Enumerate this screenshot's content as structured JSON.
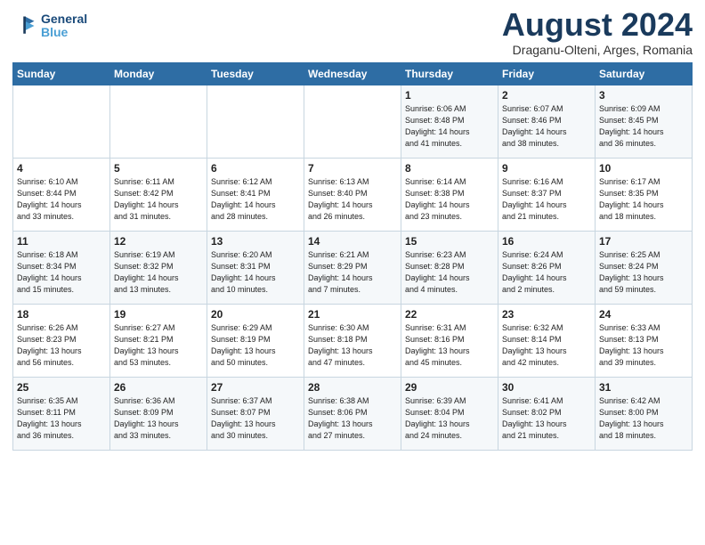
{
  "header": {
    "logo_line1": "General",
    "logo_line2": "Blue",
    "month": "August 2024",
    "location": "Draganu-Olteni, Arges, Romania"
  },
  "days_of_week": [
    "Sunday",
    "Monday",
    "Tuesday",
    "Wednesday",
    "Thursday",
    "Friday",
    "Saturday"
  ],
  "weeks": [
    [
      {
        "day": "",
        "info": ""
      },
      {
        "day": "",
        "info": ""
      },
      {
        "day": "",
        "info": ""
      },
      {
        "day": "",
        "info": ""
      },
      {
        "day": "1",
        "info": "Sunrise: 6:06 AM\nSunset: 8:48 PM\nDaylight: 14 hours\nand 41 minutes."
      },
      {
        "day": "2",
        "info": "Sunrise: 6:07 AM\nSunset: 8:46 PM\nDaylight: 14 hours\nand 38 minutes."
      },
      {
        "day": "3",
        "info": "Sunrise: 6:09 AM\nSunset: 8:45 PM\nDaylight: 14 hours\nand 36 minutes."
      }
    ],
    [
      {
        "day": "4",
        "info": "Sunrise: 6:10 AM\nSunset: 8:44 PM\nDaylight: 14 hours\nand 33 minutes."
      },
      {
        "day": "5",
        "info": "Sunrise: 6:11 AM\nSunset: 8:42 PM\nDaylight: 14 hours\nand 31 minutes."
      },
      {
        "day": "6",
        "info": "Sunrise: 6:12 AM\nSunset: 8:41 PM\nDaylight: 14 hours\nand 28 minutes."
      },
      {
        "day": "7",
        "info": "Sunrise: 6:13 AM\nSunset: 8:40 PM\nDaylight: 14 hours\nand 26 minutes."
      },
      {
        "day": "8",
        "info": "Sunrise: 6:14 AM\nSunset: 8:38 PM\nDaylight: 14 hours\nand 23 minutes."
      },
      {
        "day": "9",
        "info": "Sunrise: 6:16 AM\nSunset: 8:37 PM\nDaylight: 14 hours\nand 21 minutes."
      },
      {
        "day": "10",
        "info": "Sunrise: 6:17 AM\nSunset: 8:35 PM\nDaylight: 14 hours\nand 18 minutes."
      }
    ],
    [
      {
        "day": "11",
        "info": "Sunrise: 6:18 AM\nSunset: 8:34 PM\nDaylight: 14 hours\nand 15 minutes."
      },
      {
        "day": "12",
        "info": "Sunrise: 6:19 AM\nSunset: 8:32 PM\nDaylight: 14 hours\nand 13 minutes."
      },
      {
        "day": "13",
        "info": "Sunrise: 6:20 AM\nSunset: 8:31 PM\nDaylight: 14 hours\nand 10 minutes."
      },
      {
        "day": "14",
        "info": "Sunrise: 6:21 AM\nSunset: 8:29 PM\nDaylight: 14 hours\nand 7 minutes."
      },
      {
        "day": "15",
        "info": "Sunrise: 6:23 AM\nSunset: 8:28 PM\nDaylight: 14 hours\nand 4 minutes."
      },
      {
        "day": "16",
        "info": "Sunrise: 6:24 AM\nSunset: 8:26 PM\nDaylight: 14 hours\nand 2 minutes."
      },
      {
        "day": "17",
        "info": "Sunrise: 6:25 AM\nSunset: 8:24 PM\nDaylight: 13 hours\nand 59 minutes."
      }
    ],
    [
      {
        "day": "18",
        "info": "Sunrise: 6:26 AM\nSunset: 8:23 PM\nDaylight: 13 hours\nand 56 minutes."
      },
      {
        "day": "19",
        "info": "Sunrise: 6:27 AM\nSunset: 8:21 PM\nDaylight: 13 hours\nand 53 minutes."
      },
      {
        "day": "20",
        "info": "Sunrise: 6:29 AM\nSunset: 8:19 PM\nDaylight: 13 hours\nand 50 minutes."
      },
      {
        "day": "21",
        "info": "Sunrise: 6:30 AM\nSunset: 8:18 PM\nDaylight: 13 hours\nand 47 minutes."
      },
      {
        "day": "22",
        "info": "Sunrise: 6:31 AM\nSunset: 8:16 PM\nDaylight: 13 hours\nand 45 minutes."
      },
      {
        "day": "23",
        "info": "Sunrise: 6:32 AM\nSunset: 8:14 PM\nDaylight: 13 hours\nand 42 minutes."
      },
      {
        "day": "24",
        "info": "Sunrise: 6:33 AM\nSunset: 8:13 PM\nDaylight: 13 hours\nand 39 minutes."
      }
    ],
    [
      {
        "day": "25",
        "info": "Sunrise: 6:35 AM\nSunset: 8:11 PM\nDaylight: 13 hours\nand 36 minutes."
      },
      {
        "day": "26",
        "info": "Sunrise: 6:36 AM\nSunset: 8:09 PM\nDaylight: 13 hours\nand 33 minutes."
      },
      {
        "day": "27",
        "info": "Sunrise: 6:37 AM\nSunset: 8:07 PM\nDaylight: 13 hours\nand 30 minutes."
      },
      {
        "day": "28",
        "info": "Sunrise: 6:38 AM\nSunset: 8:06 PM\nDaylight: 13 hours\nand 27 minutes."
      },
      {
        "day": "29",
        "info": "Sunrise: 6:39 AM\nSunset: 8:04 PM\nDaylight: 13 hours\nand 24 minutes."
      },
      {
        "day": "30",
        "info": "Sunrise: 6:41 AM\nSunset: 8:02 PM\nDaylight: 13 hours\nand 21 minutes."
      },
      {
        "day": "31",
        "info": "Sunrise: 6:42 AM\nSunset: 8:00 PM\nDaylight: 13 hours\nand 18 minutes."
      }
    ]
  ]
}
